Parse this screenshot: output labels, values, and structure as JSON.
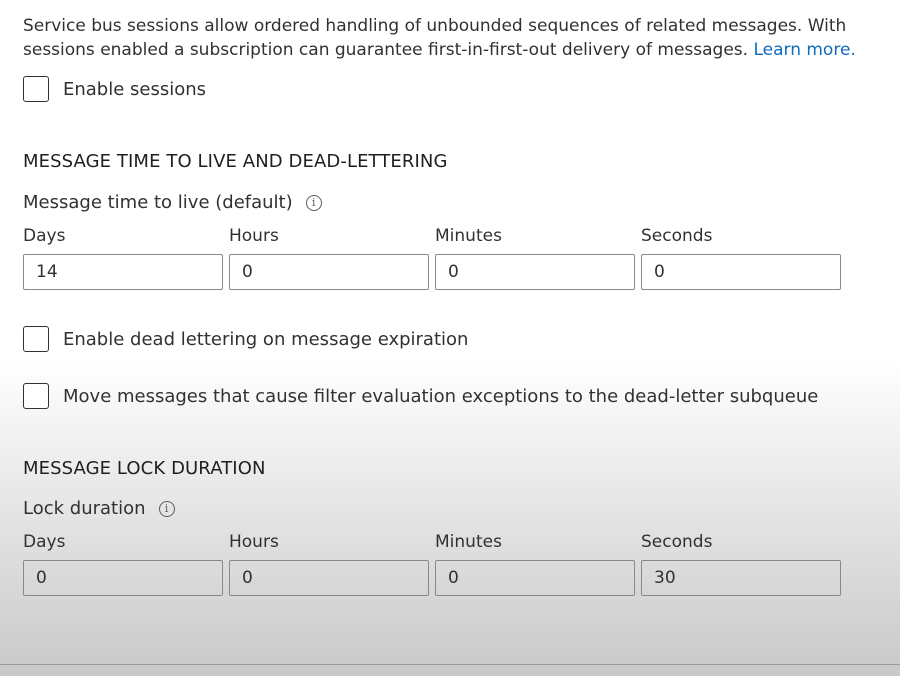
{
  "sessions": {
    "description": "Service bus sessions allow ordered handling of unbounded sequences of related messages. With sessions enabled a subscription can guarantee first-in-first-out delivery of messages.",
    "learn_more": "Learn more.",
    "enable_label": "Enable sessions"
  },
  "ttl": {
    "section_title": "MESSAGE TIME TO LIVE AND DEAD-LETTERING",
    "field_label": "Message time to live (default)",
    "columns": [
      "Days",
      "Hours",
      "Minutes",
      "Seconds"
    ],
    "values": [
      "14",
      "0",
      "0",
      "0"
    ],
    "dead_letter_expiration_label": "Enable dead lettering on message expiration",
    "filter_exceptions_label": "Move messages that cause filter evaluation exceptions to the dead-letter subqueue"
  },
  "lock": {
    "section_title": "MESSAGE LOCK DURATION",
    "field_label": "Lock duration",
    "columns": [
      "Days",
      "Hours",
      "Minutes",
      "Seconds"
    ],
    "values": [
      "0",
      "0",
      "0",
      "30"
    ]
  },
  "icons": {
    "info_glyph": "i"
  }
}
